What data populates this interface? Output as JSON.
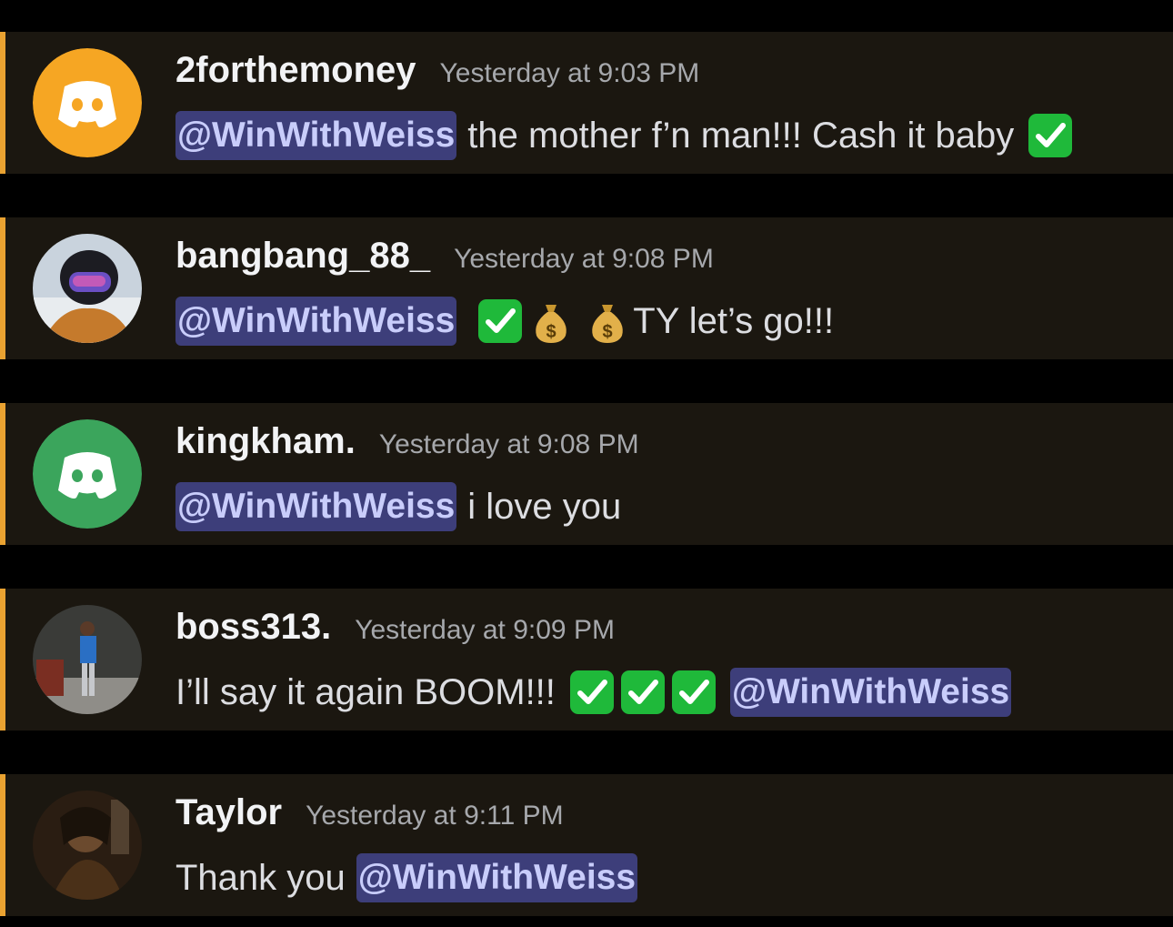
{
  "messages": [
    {
      "username": "2forthemoney",
      "timestamp": "Yesterday at 9:03 PM",
      "avatar": {
        "type": "discord-logo",
        "color": "#f6a623"
      },
      "mention": "@WinWithWeiss",
      "text": "the mother f’n man!!! Cash it baby",
      "emojis": [
        "white-check-mark"
      ]
    },
    {
      "username": "bangbang_88_",
      "timestamp": "Yesterday at 9:08 PM",
      "avatar": {
        "type": "photo",
        "description_icon": "helmet-photo"
      },
      "mention": "@WinWithWeiss",
      "emojis": [
        "white-check-mark",
        "money-bag",
        "money-bag"
      ],
      "text": "TY let’s go!!!"
    },
    {
      "username": "kingkham.",
      "timestamp": "Yesterday at 9:08 PM",
      "avatar": {
        "type": "discord-logo",
        "color": "#3ba55c"
      },
      "mention": "@WinWithWeiss",
      "text": "i love you"
    },
    {
      "username": "boss313.",
      "timestamp": "Yesterday at 9:09 PM",
      "avatar": {
        "type": "photo",
        "description_icon": "person-photo"
      },
      "text": "I’ll say it again BOOM!!!",
      "emojis": [
        "white-check-mark",
        "white-check-mark",
        "white-check-mark"
      ],
      "mention": "@WinWithWeiss"
    },
    {
      "username": "Taylor",
      "timestamp": "Yesterday at 9:11 PM",
      "avatar": {
        "type": "photo",
        "description_icon": "portrait-photo"
      },
      "text": "Thank you",
      "mention": "@WinWithWeiss"
    }
  ],
  "colors": {
    "message_bg": "#1b1710",
    "accent_bar": "#e9a231",
    "mention_bg": "#3d3e7a",
    "mention_text": "#c9cdfb",
    "check_green": "#1fb93a"
  }
}
